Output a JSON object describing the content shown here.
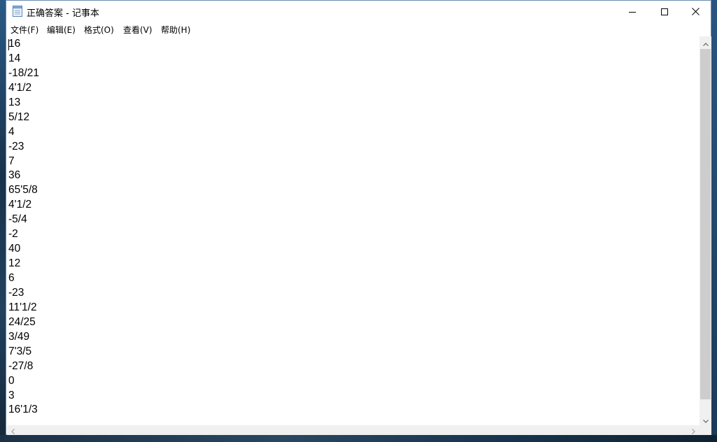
{
  "window": {
    "title": "正确答案 - 记事本",
    "icon": "notepad-icon",
    "controls": {
      "minimize": "minimize-icon",
      "maximize": "maximize-icon",
      "close": "close-icon"
    }
  },
  "menubar": {
    "items": [
      {
        "label": "文件(F)"
      },
      {
        "label": "编辑(E)"
      },
      {
        "label": "格式(O)"
      },
      {
        "label": "查看(V)"
      },
      {
        "label": "帮助(H)"
      }
    ]
  },
  "editor": {
    "lines": [
      "16",
      "14",
      "-18/21",
      "4'1/2",
      "13",
      "5/12",
      "4",
      "-23",
      "7",
      "36",
      "65'5/8",
      "4'1/2",
      "-5/4",
      "-2",
      "40",
      "12",
      "6",
      "-23",
      "11'1/2",
      "24/25",
      "3/49",
      "7'3/5",
      "-27/8",
      "0",
      "3",
      "16'1/3"
    ]
  },
  "colors": {
    "window_border": "#6a8bb0",
    "scroll_track": "#f0f0f0",
    "scroll_thumb": "#cdcdcd"
  }
}
